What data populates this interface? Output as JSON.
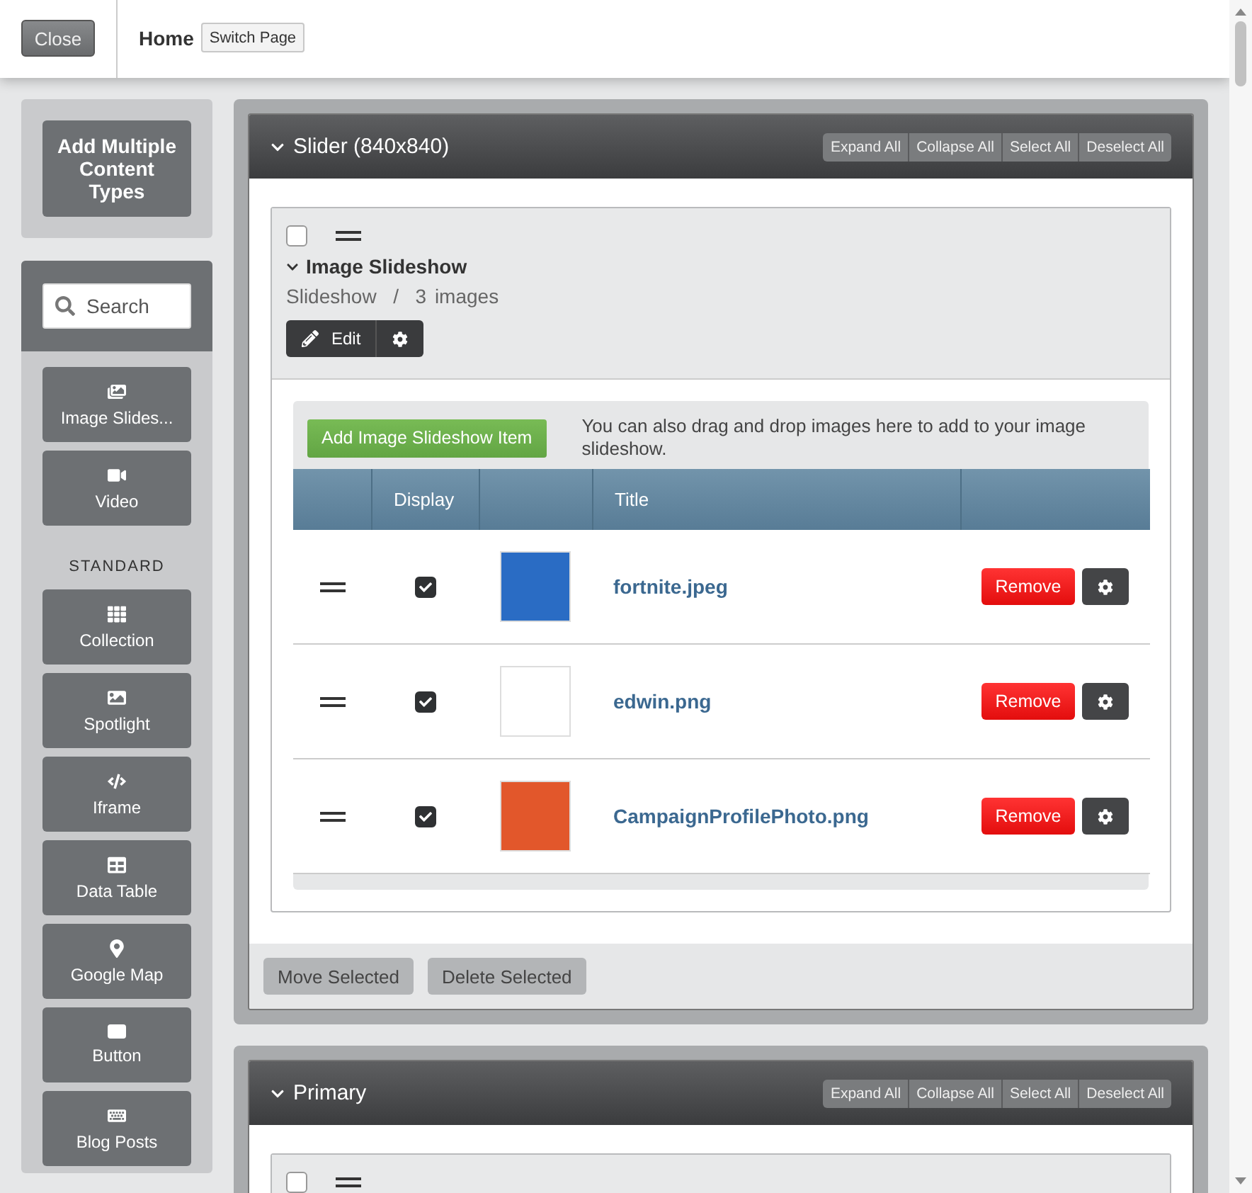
{
  "top_bar": {
    "close": "Close",
    "title": "Home",
    "switch_page": "Switch Page"
  },
  "sidebar": {
    "add_multiple": "Add Multiple Content Types",
    "search": {
      "placeholder": "Search"
    },
    "items": [
      {
        "label": "Image Slides...",
        "kind": "slideshow"
      },
      {
        "label": "Video",
        "kind": "video"
      }
    ],
    "section_label": "STANDARD",
    "standard_items": [
      {
        "label": "Collection",
        "kind": "collection"
      },
      {
        "label": "Spotlight",
        "kind": "spotlight"
      },
      {
        "label": "Iframe",
        "kind": "iframe"
      },
      {
        "label": "Data Table",
        "kind": "table"
      },
      {
        "label": "Google Map",
        "kind": "map"
      },
      {
        "label": "Button",
        "kind": "button"
      },
      {
        "label": "Blog Posts",
        "kind": "blog"
      }
    ]
  },
  "sections": [
    {
      "title": "Slider (840x840)",
      "expanded": true,
      "actions": [
        "Expand All",
        "Collapse All",
        "Select All",
        "Deselect All"
      ],
      "blocks": [
        {
          "checked": false,
          "expanded": true,
          "title": "Image Slideshow",
          "meta": [
            "Slideshow",
            "/",
            "3 images"
          ],
          "edit": "Edit",
          "add_button": "Add Image Slideshow Item",
          "hint": "You can also drag and drop images here to add to your image slideshow.",
          "columns": {
            "display": "Display",
            "title": "Title"
          },
          "rows": [
            {
              "display": true,
              "color": "#2a6cc4",
              "title": "fortnite.jpeg",
              "remove": "Remove"
            },
            {
              "display": true,
              "color": "#ffffff",
              "title": "edwin.png",
              "remove": "Remove"
            },
            {
              "display": true,
              "color": "#e2572b",
              "title": "CampaignProfilePhoto.png",
              "remove": "Remove"
            }
          ]
        }
      ],
      "footer": [
        "Move Selected",
        "Delete Selected"
      ]
    },
    {
      "title": "Primary",
      "expanded": true,
      "actions": [
        "Expand All",
        "Collapse All",
        "Select All",
        "Deselect All"
      ],
      "blocks": [
        {
          "checked": false
        }
      ]
    }
  ]
}
